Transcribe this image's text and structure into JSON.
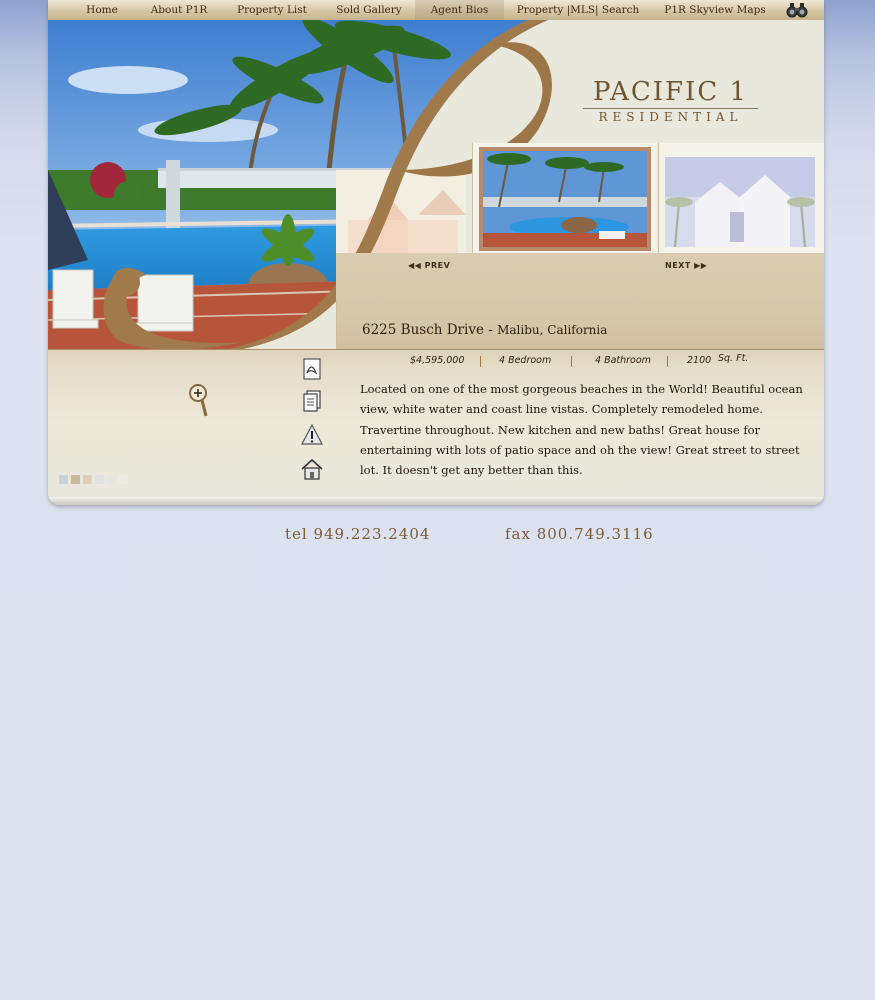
{
  "nav": {
    "items": [
      {
        "label": "Home"
      },
      {
        "label": "About P1R"
      },
      {
        "label": "Property List"
      },
      {
        "label": "Sold Gallery"
      },
      {
        "label": "Agent Bios"
      },
      {
        "label": "Property |MLS| Search"
      },
      {
        "label": "P1R Skyview Maps"
      }
    ],
    "active": "Agent Bios",
    "search_icon": "binoculars-icon"
  },
  "brand": {
    "name": "PACIFIC 1",
    "sub": "RESIDENTIAL"
  },
  "carousel": {
    "prev_label": "PREV",
    "next_label": "NEXT"
  },
  "listing": {
    "street": "6225 Busch Drive",
    "dash": "-",
    "city": "Malibu, California",
    "price": "$4,595,000",
    "bedrooms": "4 Bedroom",
    "bathrooms": "4 Bathroom",
    "sqft_value": "2100",
    "sqft_unit": "Sq. Ft.",
    "description": "Located on one of the most gorgeous beaches in the World! Beautiful ocean view, white water and coast line vistas. Completely remodeled home. Travertine throughout.  New kitchen and new baths! Great house for entertaining with lots of patio space and oh the view! Great street to street lot. It doesn't get any better than this."
  },
  "tools": {
    "icons": [
      "pdf-icon",
      "document-icon",
      "alert-icon",
      "home-icon",
      "zoom-icon"
    ]
  },
  "contact": {
    "tel": "tel 949.223.2404",
    "fax": "fax 800.749.3116"
  },
  "colors": {
    "accent": "#a07a4a",
    "brand_text": "#6e5633",
    "background": "#dce2ee"
  }
}
